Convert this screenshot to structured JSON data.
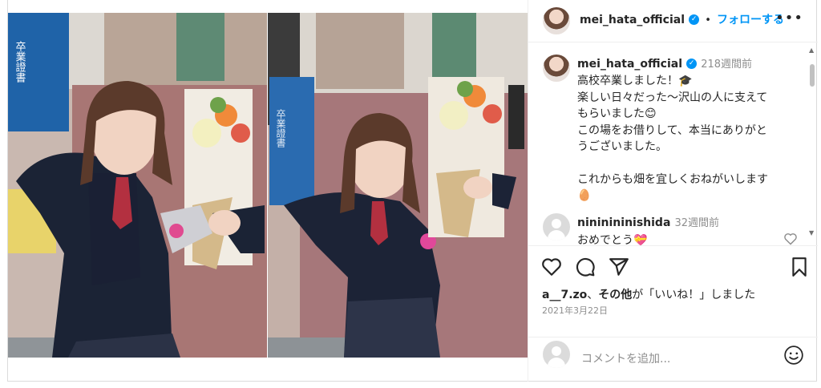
{
  "post": {
    "username": "mei_hata_official",
    "follow_label": "フォローする",
    "separator": "•",
    "more_label": "•••"
  },
  "caption": {
    "username": "mei_hata_official",
    "time_ago": "218週間前",
    "lines": [
      "高校卒業しました！🎓",
      "楽しい日々だった〜沢山の人に支えて",
      "もらいました😊",
      "この場をお借りして、本当にありがと",
      "うございました。",
      "",
      "これからも畑を宜しくおねがいします",
      "🥚"
    ]
  },
  "comments": [
    {
      "username": "nininininishida",
      "time_ago": "32週間前",
      "text": "おめでとう💝"
    }
  ],
  "photo_text": {
    "certificate_1": "卒業證書",
    "certificate_2": "卒業證書"
  },
  "likes": {
    "user": "a__7.zo",
    "sep": "、",
    "others": "その他",
    "suffix": "が「いいね！」しました"
  },
  "date": "2021年3月22日",
  "add_comment": {
    "placeholder": "コメントを追加..."
  },
  "colors": {
    "accent": "#0095f6",
    "text": "#262626",
    "muted": "#8e8e8e",
    "border": "#dbdbdb"
  },
  "icons": [
    "verified-badge-icon",
    "more-options-icon",
    "heart-icon",
    "comment-icon",
    "share-icon",
    "bookmark-icon",
    "emoji-icon",
    "scroll-up-icon",
    "scroll-down-icon"
  ]
}
